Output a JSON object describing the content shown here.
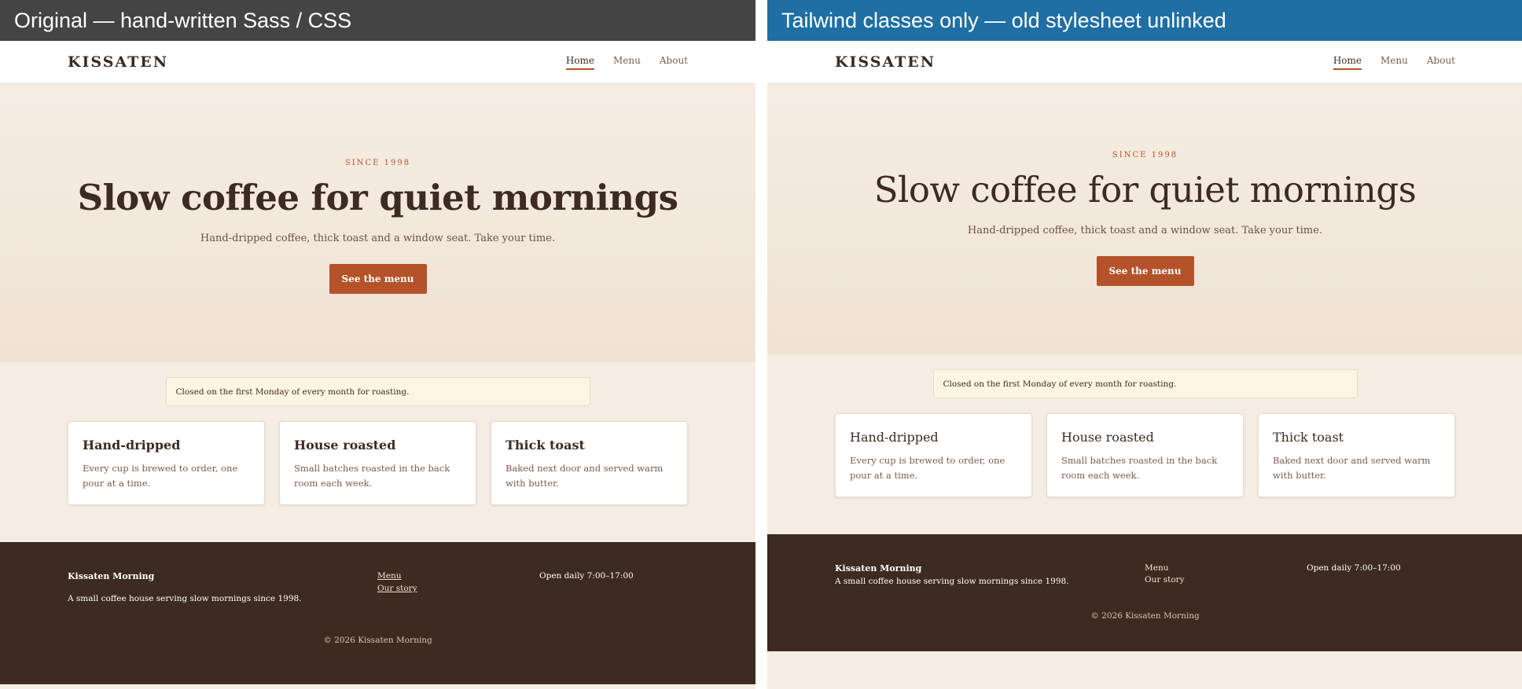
{
  "panes": [
    {
      "header": "Original — hand-written Sass / CSS",
      "header_color": "#444444",
      "site": {
        "logo": "KISSATEN",
        "nav": [
          "Home",
          "Menu",
          "About"
        ],
        "active_nav": "Home",
        "hero": {
          "eyebrow": "SINCE 1998",
          "title": "Slow coffee for quiet mornings",
          "subtitle": "Hand-dripped coffee, thick toast and a window seat. Take your time.",
          "cta": "See the menu"
        },
        "notice": "Closed on the first Monday of every month for roasting.",
        "cards": [
          {
            "title": "Hand-dripped",
            "text": "Every cup is brewed to order, one pour at a time."
          },
          {
            "title": "House roasted",
            "text": "Small batches roasted in the back room each week."
          },
          {
            "title": "Thick toast",
            "text": "Baked next door and served warm with butter."
          }
        ],
        "footer": {
          "brand": "Kissaten Morning",
          "description": "A small coffee house serving slow mornings since 1998.",
          "links": [
            "Menu",
            "Our story"
          ],
          "hours": "Open daily 7:00–17:00",
          "copyright": "© 2026 Kissaten Morning"
        }
      }
    },
    {
      "header": "Tailwind classes only — old stylesheet unlinked",
      "header_color": "#1f6fa5",
      "site": {
        "logo": "KISSATEN",
        "nav": [
          "Home",
          "Menu",
          "About"
        ],
        "active_nav": "Home",
        "hero": {
          "eyebrow": "SINCE 1998",
          "title": "Slow coffee for quiet mornings",
          "subtitle": "Hand-dripped coffee, thick toast and a window seat. Take your time.",
          "cta": "See the menu"
        },
        "notice": "Closed on the first Monday of every month for roasting.",
        "cards": [
          {
            "title": "Hand-dripped",
            "text": "Every cup is brewed to order, one pour at a time."
          },
          {
            "title": "House roasted",
            "text": "Small batches roasted in the back room each week."
          },
          {
            "title": "Thick toast",
            "text": "Baked next door and served warm with butter."
          }
        ],
        "footer": {
          "brand": "Kissaten Morning",
          "description": "A small coffee house serving slow mornings since 1998.",
          "links": [
            "Menu",
            "Our story"
          ],
          "hours": "Open daily 7:00–17:00",
          "copyright": "© 2026 Kissaten Morning"
        }
      }
    }
  ],
  "colors": {
    "accent": "#b4532a",
    "espresso": "#3d2a20",
    "cream": "#f5ede3",
    "notice_bg": "#fdf5e3"
  }
}
